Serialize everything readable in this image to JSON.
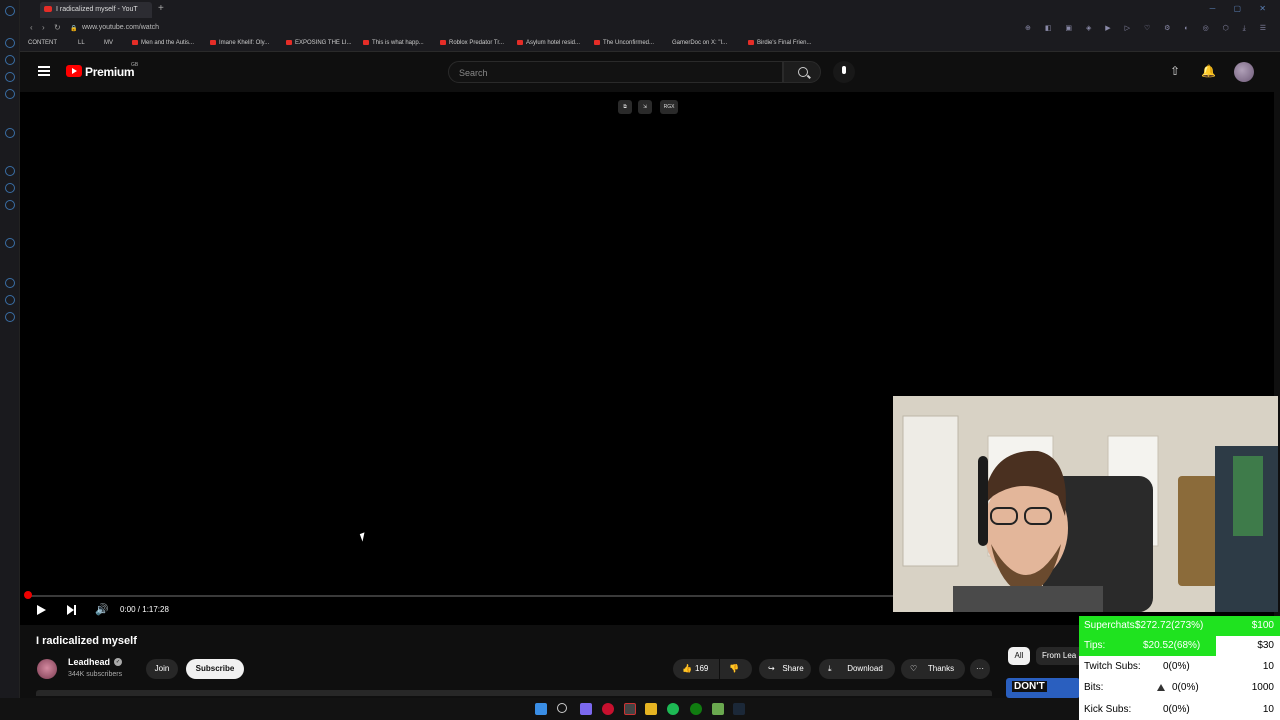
{
  "browser": {
    "tab_title": "I radicalized myself - YouT",
    "url": "www.youtube.com/watch",
    "bookmarks": [
      "CONTENT",
      "LL",
      "MV",
      "Men and the Autis...",
      "Imane Khelif: Oly...",
      "EXPOSING THE LI...",
      "This is what happ...",
      "Roblox Predator Tr...",
      "Asylum hotel resid...",
      "The Unconfirmed...",
      "GamerDoc on X: \"I...",
      "Birdie's Final Frien..."
    ]
  },
  "header": {
    "logo_text": "Premium",
    "logo_sup": "GB",
    "search_placeholder": "Search"
  },
  "player": {
    "overlay_label": "RGX",
    "time": "0:00 / 1:17:28"
  },
  "video": {
    "title": "I radicalized myself",
    "channel": "Leadhead",
    "subscribers": "344K subscribers",
    "join_label": "Join",
    "subscribe_label": "Subscribe",
    "likes": "169",
    "share_label": "Share",
    "download_label": "Download",
    "thanks_label": "Thanks",
    "more_label": "···"
  },
  "sidebar_chips": {
    "all_label": "All",
    "from_label": "From Lea"
  },
  "thumbnail_text": "DON'T",
  "stats": [
    {
      "label": "Superchats:",
      "value": "$272.72(273%)",
      "goal": "$100",
      "progress": 1.0
    },
    {
      "label": "Tips:",
      "value": "$20.52(68%)",
      "goal": "$30",
      "progress": 0.68
    },
    {
      "label": "Twitch Subs:",
      "value": "0(0%)",
      "goal": "10",
      "progress": 0
    },
    {
      "label": "Bits:",
      "value": "0(0%)",
      "goal": "1000",
      "progress": 0
    },
    {
      "label": "Kick Subs:",
      "value": "0(0%)",
      "goal": "10",
      "progress": 0
    }
  ],
  "colors": {
    "accent_red": "#ff0000",
    "progress_green": "#1fe31f",
    "background": "#0f0f0f"
  }
}
